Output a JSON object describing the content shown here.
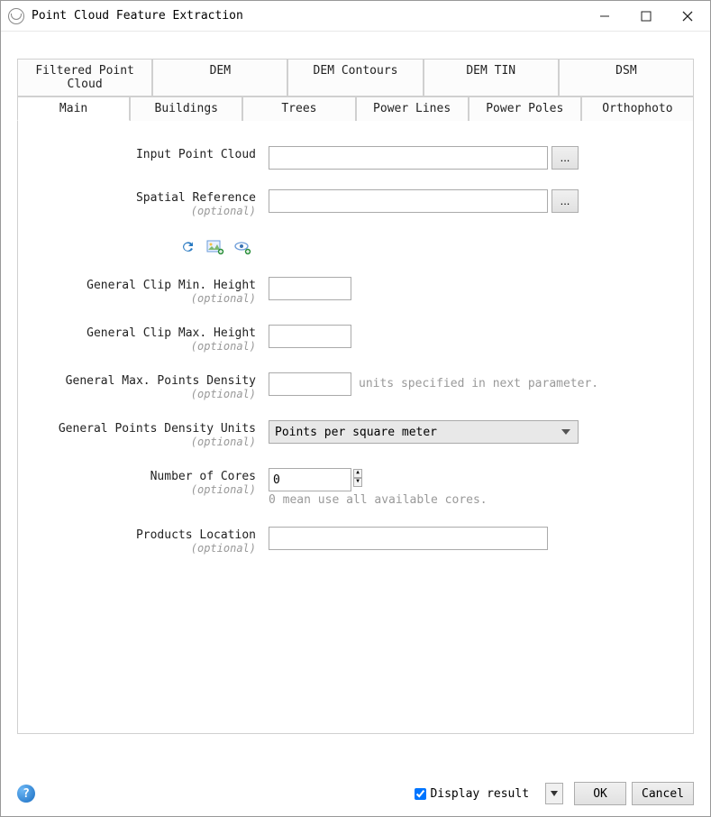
{
  "window": {
    "title": "Point Cloud Feature Extraction"
  },
  "tabs": {
    "row1": [
      "Filtered Point Cloud",
      "DEM",
      "DEM Contours",
      "DEM TIN",
      "DSM"
    ],
    "row2": [
      "Main",
      "Buildings",
      "Trees",
      "Power Lines",
      "Power Poles",
      "Orthophoto"
    ],
    "active": "Main"
  },
  "form": {
    "optional_label": "(optional)",
    "input_point_cloud": {
      "label": "Input Point Cloud",
      "value": "",
      "browse": "..."
    },
    "spatial_reference": {
      "label": "Spatial Reference",
      "value": "",
      "browse": "..."
    },
    "clip_min": {
      "label": "General Clip Min. Height",
      "value": ""
    },
    "clip_max": {
      "label": "General Clip Max. Height",
      "value": ""
    },
    "max_density": {
      "label": "General Max. Points Density",
      "value": "",
      "hint": "units specified in next parameter."
    },
    "density_units": {
      "label": "General Points Density Units",
      "selected": "Points per square meter"
    },
    "cores": {
      "label": "Number of Cores",
      "value": "0",
      "hint": "0 mean use all available cores."
    },
    "products_location": {
      "label": "Products Location",
      "value": ""
    }
  },
  "footer": {
    "display_result": "Display result",
    "ok": "OK",
    "cancel": "Cancel"
  }
}
